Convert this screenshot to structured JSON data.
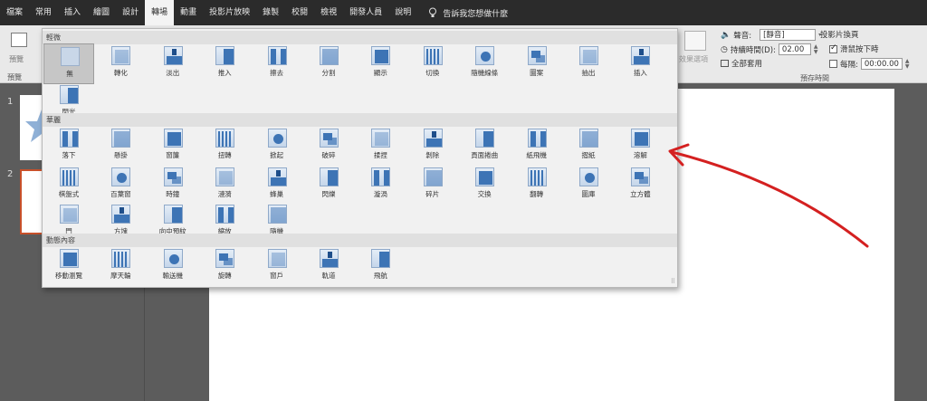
{
  "tabs": [
    "檔案",
    "常用",
    "插入",
    "繪圖",
    "設計",
    "轉場",
    "動畫",
    "投影片放映",
    "錄製",
    "校閱",
    "檢視",
    "開發人員",
    "說明"
  ],
  "active_tab_index": 5,
  "tell_me": "告訴我您想做什麼",
  "ribbon": {
    "preview_label": "預覽",
    "preview_group_label": "預覽",
    "effect_options_label": "效果選項",
    "timing": {
      "sound_label": "聲音:",
      "sound_value": "[靜音]",
      "duration_label": "持續時間(D):",
      "duration_value": "02.00",
      "apply_all_label": "全部套用",
      "advance_title": "投影片換頁",
      "on_click_label": "滑鼠按下時",
      "on_click_checked": true,
      "after_label": "每隔:",
      "after_value": "00:00.00",
      "after_checked": false,
      "group_label": "預存時間"
    }
  },
  "thumbnails": [
    {
      "number": "1",
      "selected": false
    },
    {
      "number": "2",
      "selected": true
    }
  ],
  "gallery": {
    "sections": [
      {
        "title": "輕微",
        "items": [
          "無",
          "轉化",
          "淡出",
          "推入",
          "擦去",
          "分割",
          "顯示",
          "切換",
          "隨機線條",
          "圖案",
          "抽出",
          "插入",
          "閃光"
        ]
      },
      {
        "title": "華麗",
        "items": [
          "落下",
          "懸掛",
          "窗簾",
          "扭轉",
          "掀起",
          "破碎",
          "揉捏",
          "剝除",
          "頁面捲曲",
          "紙飛機",
          "摺紙",
          "溶解",
          "棋盤式",
          "百葉窗",
          "時鐘",
          "漣漪",
          "蜂巢",
          "閃爍",
          "漩渦",
          "碎片",
          "交換",
          "翻轉",
          "圖庫",
          "立方體",
          "門",
          "方塊",
          "向中預紋",
          "縮放",
          "隨機"
        ]
      },
      {
        "title": "動態內容",
        "items": [
          "移動瀏覽",
          "摩天輪",
          "輸送機",
          "旋轉",
          "窗戶",
          "軌道",
          "飛航"
        ]
      }
    ],
    "selected_item": "無"
  },
  "annotation": {
    "color": "#d42020",
    "points_to": "溶解"
  }
}
